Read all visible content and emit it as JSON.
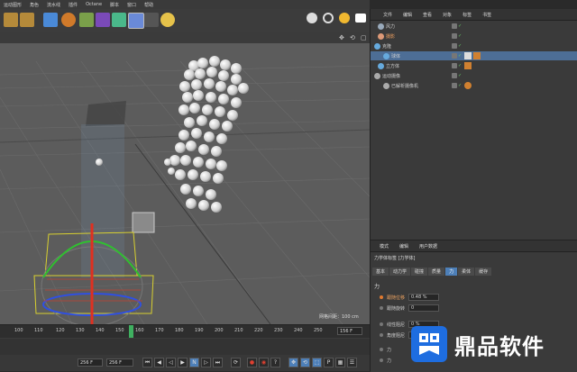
{
  "menu": [
    "运动图形",
    "角色",
    "流水线",
    "插件",
    "Octane",
    "脚本",
    "窗口",
    "帮助"
  ],
  "objects": [
    {
      "name": "风力",
      "color": "#9ab"
    },
    {
      "name": "摄影",
      "color": "#d97"
    },
    {
      "name": "克隆",
      "color": "#6ad"
    },
    {
      "name": "球体",
      "color": "#6ad"
    },
    {
      "name": "立方体",
      "color": "#6ad"
    },
    {
      "name": "运动摄像",
      "color": "#aaa"
    },
    {
      "name": "已解析摄像机",
      "color": "#aaa"
    }
  ],
  "om_tabs": [
    "文件",
    "编辑",
    "查看",
    "对象",
    "标签",
    "书签"
  ],
  "attr_tabs": [
    "模式",
    "编辑",
    "用户数据"
  ],
  "attr_title": "力学体标签 [力学体]",
  "attr_subtabs": [
    "基本",
    "动力学",
    "碰撞",
    "质量",
    "力",
    "柔体",
    "缓存"
  ],
  "attr_active_tab": "力",
  "attr_section": "力",
  "attr_rows": [
    {
      "label": "跟随位移",
      "value": "0.48 %"
    },
    {
      "label": "跟随旋转",
      "value": "0"
    },
    {
      "label": "线性阻尼",
      "value": "0 %"
    },
    {
      "label": "角度阻尼",
      "value": "0 %"
    },
    {
      "label": "力",
      "value": ""
    },
    {
      "label": "力",
      "value": ""
    }
  ],
  "viewport": {
    "label": "网格间距：100 cm"
  },
  "timeline": {
    "ticks": [
      "100",
      "110",
      "120",
      "130",
      "140",
      "150",
      "160",
      "170",
      "180",
      "190",
      "200",
      "210",
      "220",
      "230",
      "240",
      "250"
    ],
    "current_frame": "156 F",
    "start_frame": "256 F",
    "end_frame": "256 F"
  },
  "watermark": {
    "text": "鼎品软件"
  },
  "colors": {
    "accent": "#4d7fb8",
    "watermark": "#1e6de0"
  }
}
